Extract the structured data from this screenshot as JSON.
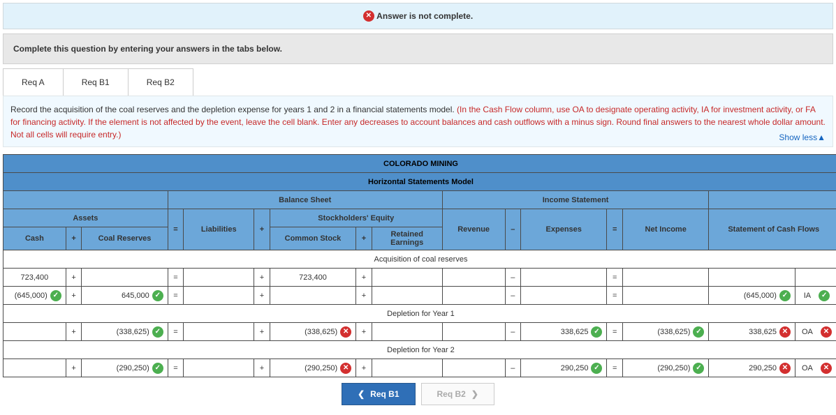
{
  "banner": {
    "text": "Answer is not complete."
  },
  "instruction": "Complete this question by entering your answers in the tabs below.",
  "tabs": {
    "a": "Req A",
    "b1": "Req B1",
    "b2": "Req B2"
  },
  "panel": {
    "plain": "Record the acquisition of the coal reserves and the depletion expense for years 1 and 2 in a financial statements model. ",
    "red": "(In the Cash Flow column, use OA to designate operating activity, IA for investment activity, or FA for financing activity. If the element is not affected by the event, leave the cell blank. Enter any decreases to account balances and cash outflows with a minus sign. Round final answers to the nearest whole dollar amount. Not all cells will require entry.)",
    "showless": "Show less"
  },
  "headers": {
    "company": "COLORADO MINING",
    "model": "Horizontal Statements Model",
    "balance_sheet": "Balance Sheet",
    "income_statement": "Income Statement",
    "assets": "Assets",
    "liabilities": "Liabilities",
    "stockholders_equity": "Stockholders' Equity",
    "revenue": "Revenue",
    "expenses": "Expenses",
    "net_income": "Net Income",
    "cash_flows": "Statement of Cash Flows",
    "cash": "Cash",
    "coal_reserves": "Coal Reserves",
    "common_stock": "Common Stock",
    "retained_earnings": "Retained Earnings"
  },
  "ops": {
    "plus": "+",
    "minus": "–",
    "equals": "="
  },
  "sections": {
    "acq": "Acquisition of coal reserves",
    "y1": "Depletion for Year 1",
    "y2": "Depletion for Year 2"
  },
  "rows": {
    "r1": {
      "cash": "723,400",
      "common_stock": "723,400"
    },
    "r2": {
      "cash": "(645,000)",
      "coal": "645,000",
      "cf_amt": "(645,000)",
      "cf_type": "IA"
    },
    "y1": {
      "coal": "(338,625)",
      "common_stock": "(338,625)",
      "expenses": "338,625",
      "net_income": "(338,625)",
      "cf_amt": "338,625",
      "cf_type": "OA"
    },
    "y2": {
      "coal": "(290,250)",
      "common_stock": "(290,250)",
      "expenses": "290,250",
      "net_income": "(290,250)",
      "cf_amt": "290,250",
      "cf_type": "OA"
    }
  },
  "nav": {
    "prev": "Req B1",
    "next": "Req B2"
  }
}
